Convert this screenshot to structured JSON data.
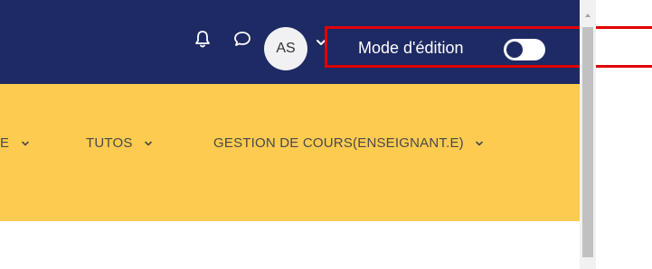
{
  "header": {
    "avatar_initials": "AS",
    "edit_mode_label": "Mode d'édition",
    "edit_mode_on": false,
    "icons": [
      "bell-icon",
      "chat-bubble-icon",
      "chevron-down-icon"
    ]
  },
  "nav": {
    "items": [
      {
        "label": "E",
        "has_dropdown": true
      },
      {
        "label": "TUTOS",
        "has_dropdown": true
      },
      {
        "label": "GESTION DE COURS(ENSEIGNANT.E)",
        "has_dropdown": true
      }
    ]
  },
  "colors": {
    "header_bg": "#1d2a63",
    "nav_bg": "#fdcb50",
    "highlight": "#e10000"
  }
}
